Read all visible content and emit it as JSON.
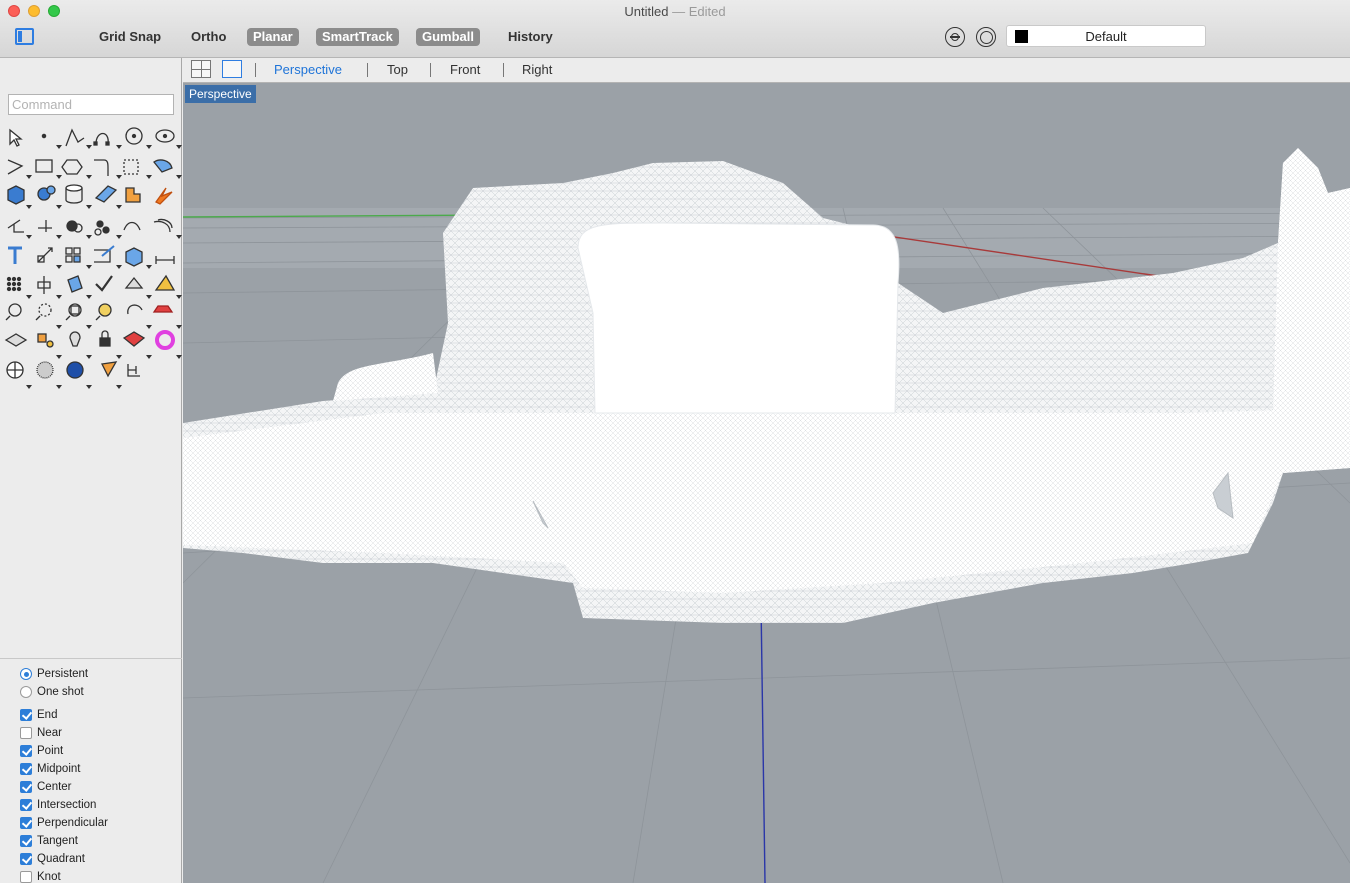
{
  "window": {
    "title": "Untitled",
    "edited": "— Edited"
  },
  "toolbar": {
    "grid_snap": "Grid Snap",
    "ortho": "Ortho",
    "planar": "Planar",
    "smarttrack": "SmartTrack",
    "gumball": "Gumball",
    "history": "History",
    "active_buttons": [
      "Planar",
      "SmartTrack",
      "Gumball"
    ],
    "layer": "Default",
    "layer_color": "#000000"
  },
  "command": {
    "placeholder": "Command"
  },
  "viewport_tabs": {
    "perspective": "Perspective",
    "top": "Top",
    "front": "Front",
    "right": "Right",
    "active": "Perspective"
  },
  "viewport": {
    "label": "Perspective",
    "background": "#9ba1a7"
  },
  "osnap": {
    "mode": {
      "persistent": "Persistent",
      "one_shot": "One shot",
      "selected": "Persistent"
    },
    "items": [
      {
        "label": "End",
        "checked": true
      },
      {
        "label": "Near",
        "checked": false
      },
      {
        "label": "Point",
        "checked": true
      },
      {
        "label": "Midpoint",
        "checked": true
      },
      {
        "label": "Center",
        "checked": true
      },
      {
        "label": "Intersection",
        "checked": true
      },
      {
        "label": "Perpendicular",
        "checked": true
      },
      {
        "label": "Tangent",
        "checked": true
      },
      {
        "label": "Quadrant",
        "checked": true
      },
      {
        "label": "Knot",
        "checked": false
      }
    ]
  },
  "tools": [
    "select-arrow-icon",
    "point-icon",
    "polyline-icon",
    "curve-icon",
    "circle-icon",
    "ellipse-icon",
    "arc-icon",
    "rectangle-icon",
    "polygon-icon",
    "fillet-curve-icon",
    "surface-from-points-icon",
    "surface-edit-icon",
    "box-icon",
    "sphere-icon",
    "cylinder-icon",
    "mesh-plane-icon",
    "boolean-puzzle-icon",
    "explode-icon",
    "extend-icon",
    "trim-icon",
    "boolean-union-icon",
    "group-icon",
    "rebuild-curve-icon",
    "offset-icon",
    "text-icon",
    "scale-icon",
    "array-icon",
    "edit-points-icon",
    "extrude-icon",
    "dimension-icon",
    "grid-array-icon",
    "align-icon",
    "paint-bucket-icon",
    "check-icon",
    "render-icon",
    "rotate-icon",
    "zoom-icon",
    "zoom-window-icon",
    "zoom-extents-icon",
    "zoom-selected-icon",
    "rotate-view-icon",
    "car-icon",
    "layer-icon",
    "materials-icon",
    "light-icon",
    "lock-icon",
    "texture-icon",
    "color-wheel-icon",
    "wireframe-sphere-icon",
    "mesh-sphere-icon",
    "shaded-sphere-icon",
    "cone-icon",
    "transform-icon"
  ]
}
